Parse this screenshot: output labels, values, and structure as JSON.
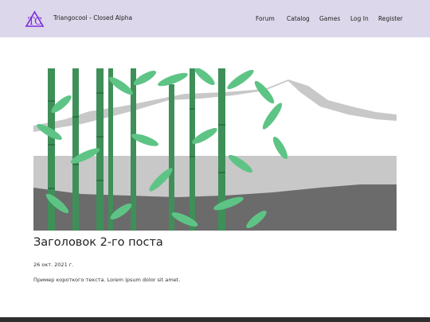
{
  "header": {
    "brand": "Triangocool - Closed Alpha",
    "logo_icon": "triangle-tc-logo-icon",
    "nav": [
      "Forum",
      "Catalog",
      "Games",
      "Log In",
      "Register"
    ]
  },
  "post": {
    "image": "bamboo-illustration",
    "title": "Заголовок 2-го поста",
    "date": "26 окт. 2021 г.",
    "excerpt": "Пример короткого текста. Lorem ipsum dolor sit amet."
  },
  "colors": {
    "header_bg": "#dcd7ea",
    "logo_purple": "#7b2ddc",
    "bamboo_dark": "#3f8f59",
    "bamboo_light": "#5ec486",
    "mountain": "#c8c8c8",
    "ground": "#6b6b6b",
    "footer": "#2f2f2f"
  }
}
